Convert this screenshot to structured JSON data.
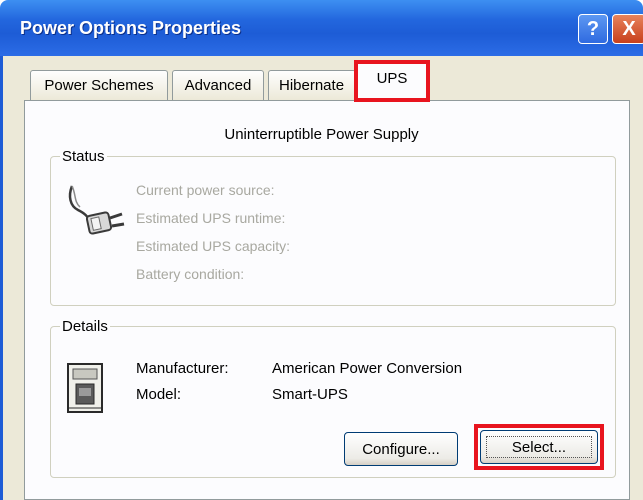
{
  "window": {
    "title": "Power Options Properties",
    "help_icon": "?",
    "close_icon": "X"
  },
  "tabs": [
    {
      "label": "Power Schemes"
    },
    {
      "label": "Advanced"
    },
    {
      "label": "Hibernate"
    },
    {
      "label": "UPS",
      "selected": true
    }
  ],
  "header": "Uninterruptible Power Supply",
  "status": {
    "label": "Status",
    "icon": "power-plug-icon",
    "lines": [
      "Current power source:",
      "Estimated UPS runtime:",
      "Estimated UPS capacity:",
      "Battery condition:"
    ]
  },
  "details": {
    "label": "Details",
    "icon": "ups-device-icon",
    "manufacturer_label": "Manufacturer:",
    "manufacturer_value": "American Power Conversion",
    "model_label": "Model:",
    "model_value": "Smart-UPS"
  },
  "buttons": {
    "configure": "Configure...",
    "select": "Select..."
  },
  "colors": {
    "titlebar": "#2367de",
    "highlight": "#e8141e",
    "disabled_text": "#a8a8a0",
    "panel_bg": "#fcfcfe"
  }
}
